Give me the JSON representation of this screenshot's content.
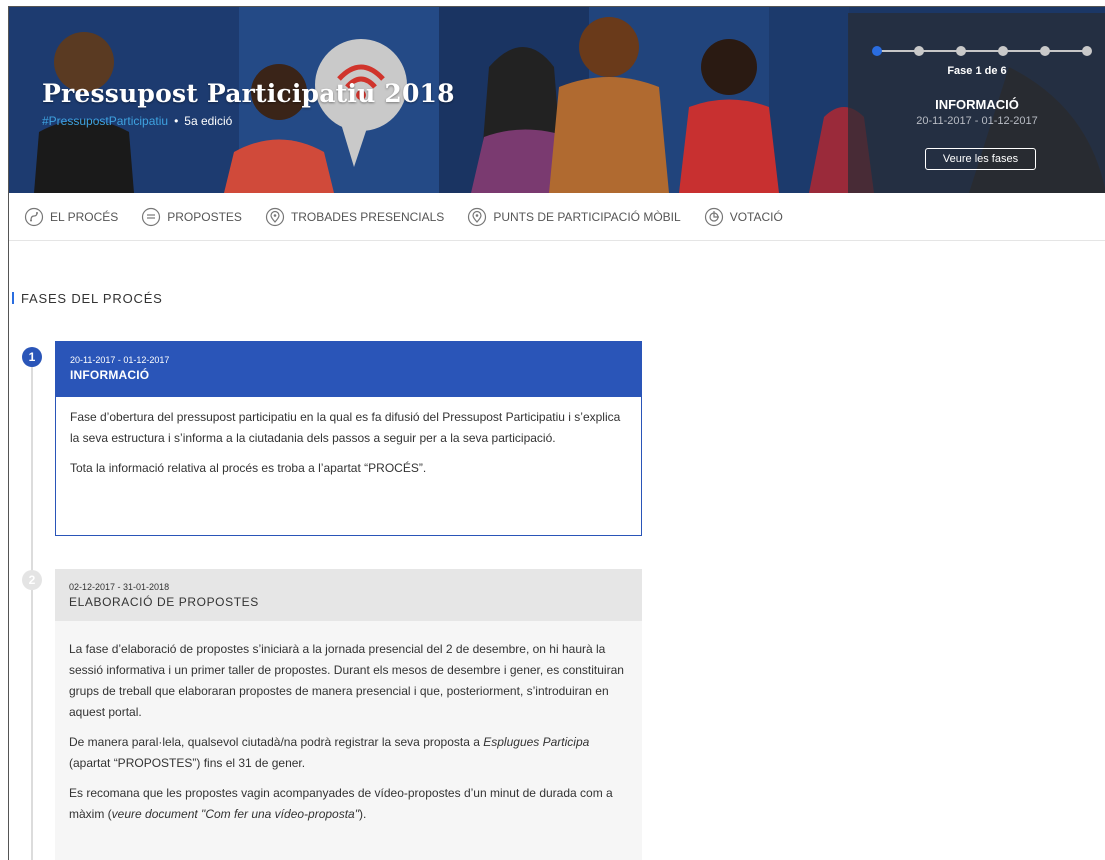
{
  "hero": {
    "title": "Pressupost Participatiu 2018",
    "hashtag": "#PressupostParticipatiu",
    "separator": "•",
    "edition": "5a edició",
    "phase_panel": {
      "count_label": "Fase 1 de 6",
      "phase_name": "INFORMACIÓ",
      "phase_dates": "20-11-2017 - 01-12-2017",
      "button_label": "Veure les fases",
      "total_phases": 6,
      "current_phase": 1
    }
  },
  "nav": {
    "items": [
      {
        "label": "El procés",
        "icon": "process-icon"
      },
      {
        "label": "Propostes",
        "icon": "proposals-icon"
      },
      {
        "label": "Trobades presencials",
        "icon": "map-pin-icon"
      },
      {
        "label": "Punts de participació mòbil",
        "icon": "map-pin-icon"
      },
      {
        "label": "Votació",
        "icon": "vote-icon"
      }
    ]
  },
  "section": {
    "title": "FASES DEL PROCÉS"
  },
  "phases": [
    {
      "number": "1",
      "dates": "20-11-2017 - 01-12-2017",
      "title": "INFORMACIÓ",
      "paragraphs": [
        "Fase d’obertura del pressupost participatiu en la qual es fa difusió del Pressupost Participatiu i s’explica la seva estructura i s’informa a la ciutadania dels passos a seguir per a la seva participació.",
        "Tota la informació relativa al procés es troba a l’apartat “PROCÉS”."
      ]
    },
    {
      "number": "2",
      "dates": "02-12-2017 - 31-01-2018",
      "title": "ELABORACIÓ DE PROPOSTES",
      "paragraphs": [
        "La fase d’elaboració de propostes s’iniciarà a la jornada presencial del 2 de desembre, on hi haurà la sessió informativa i un primer taller de propostes. Durant els mesos de desembre i gener, es constituiran grups de treball que elaboraran propostes de manera presencial i que, posteriorment, s’introduiran en aquest portal.",
        "De manera paral·lela, qualsevol ciutadà/na podrà registrar la seva proposta a",
        "Esplugues Participa",
        "(apartat “PROPOSTES”) fins el 31 de gener.",
        "Es recomana que les propostes vagin acompanyades de",
        "vídeo-propostes",
        "d’un minut de durada com a màxim (",
        "veure document \"Com fer una vídeo-proposta\"",
        ")."
      ]
    }
  ],
  "colors": {
    "accent": "#2a55b8",
    "hashtag": "#3ea2e0",
    "hero_bg": "#17305c"
  }
}
